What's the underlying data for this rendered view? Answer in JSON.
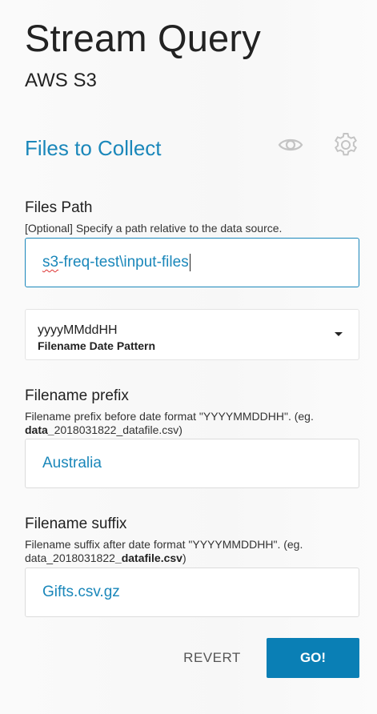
{
  "header": {
    "title": "Stream Query",
    "subtitle": "AWS S3"
  },
  "section": {
    "title": "Files to Collect",
    "icons": [
      "eye-icon",
      "gear-icon"
    ]
  },
  "files_path": {
    "label": "Files Path",
    "hint": "[Optional] Specify a path relative to the data source.",
    "value_part1": "s3",
    "value_part2": "-freq-test\\input-files"
  },
  "date_pattern": {
    "value": "yyyyMMddHH",
    "label": "Filename Date Pattern"
  },
  "filename_prefix": {
    "label": "Filename prefix",
    "hint_text": "Filename prefix before date format \"YYYYMMDDHH\". (eg. ",
    "hint_bold": "data_",
    "hint_rest": "2018031822_datafile.csv)",
    "value": "Australia"
  },
  "filename_suffix": {
    "label": "Filename suffix",
    "hint_text": "Filename suffix after date format \"YYYYMMDDHH\". (eg. data_2018031822",
    "hint_bold": "_datafile.csv",
    "hint_rest": ")",
    "value": "Gifts.csv.gz"
  },
  "actions": {
    "revert_label": "REVERT",
    "go_label": "GO!"
  },
  "colors": {
    "accent": "#1a87ba",
    "primary_button": "#0a7fb5"
  }
}
